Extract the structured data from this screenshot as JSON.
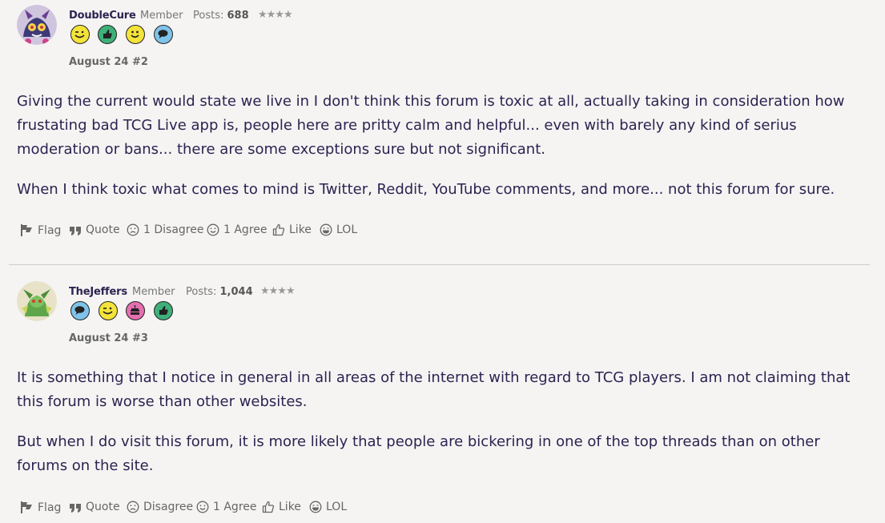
{
  "posts": [
    {
      "username": "DoubleCure",
      "role": "Member",
      "posts_label": "Posts:",
      "posts_count": "688",
      "stars": "★★★★",
      "badges": [
        "wink-badge-icon",
        "thumbs-up-badge-icon",
        "smile-badge-icon",
        "speech-bubble-badge-icon"
      ],
      "date": "August 24",
      "number": "#2",
      "paragraphs": [
        "Giving the current would state we live in I don't think this forum is toxic at all, actually taking in consideration how frustating bad TCG Live app is, people here are pritty calm and helpful... even with barely any kind of serius moderation or bans... there are some exceptions sure but not significant.",
        "When I think toxic what comes to mind is Twitter, Reddit, YouTube comments, and more... not this forum for sure."
      ],
      "actions": {
        "flag": "Flag",
        "quote": "Quote",
        "disagree": "1 Disagree",
        "agree": "1 Agree",
        "like": "Like",
        "lol": "LOL"
      }
    },
    {
      "username": "TheJeffers",
      "role": "Member",
      "posts_label": "Posts:",
      "posts_count": "1,044",
      "stars": "★★★★",
      "badges": [
        "speech-bubble-badge-icon",
        "wink-badge-icon",
        "cake-badge-icon",
        "thumbs-up-badge-icon"
      ],
      "date": "August 24",
      "number": "#3",
      "paragraphs": [
        "It is something that I notice in general in all areas of the internet with regard to TCG players. I am not claiming that this forum is worse than other websites.",
        "But when I do visit this forum, it is more likely that people are bickering in one of the top threads than on other forums on the site."
      ],
      "actions": {
        "flag": "Flag",
        "quote": "Quote",
        "disagree": "Disagree",
        "agree": "1 Agree",
        "like": "Like",
        "lol": "LOL"
      }
    }
  ],
  "colors": {
    "background": "#f5f4f3",
    "text": "#2d2350",
    "meta": "#777777",
    "badge_yellow": "#f4e33a",
    "badge_green": "#3fb07a",
    "badge_blue": "#7fc3ea",
    "badge_pink": "#e46fb0"
  }
}
